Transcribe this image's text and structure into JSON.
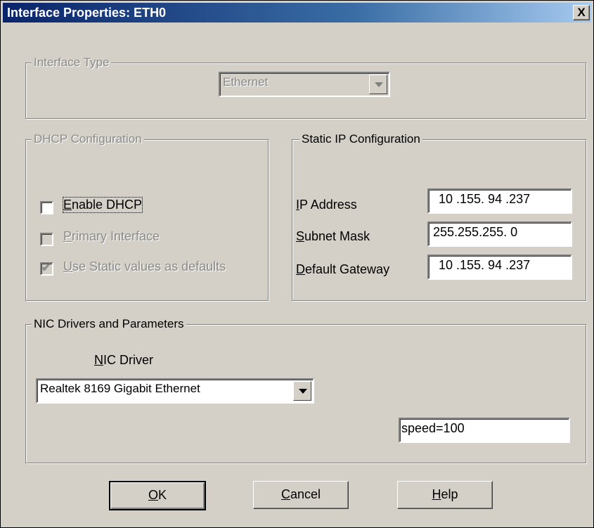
{
  "window": {
    "title": "Interface Properties: ETH0",
    "close_label": "X"
  },
  "interface_type": {
    "legend": "Interface Type",
    "selected": "Ethernet"
  },
  "dhcp": {
    "legend": "DHCP Configuration",
    "enable_dhcp": {
      "label_accel": "E",
      "label_rest": "nable DHCP",
      "checked": false
    },
    "primary_interface": {
      "label_accel": "P",
      "label_rest": "rimary Interface",
      "checked": false
    },
    "use_static_defaults": {
      "label_accel": "U",
      "label_rest": "se Static values as defaults",
      "checked": true,
      "check_glyph": "✔"
    }
  },
  "static_ip": {
    "legend": "Static IP Configuration",
    "ip_address": {
      "label_accel": "I",
      "label_rest": "P Address",
      "value": "10 .155. 94 .237"
    },
    "subnet_mask": {
      "label_accel": "S",
      "label_rest": "ubnet Mask",
      "value": "255.255.255.  0"
    },
    "default_gateway": {
      "label_accel": "D",
      "label_rest": "efault Gateway",
      "value": "10 .155. 94 .237"
    }
  },
  "nic": {
    "legend": "NIC Drivers and Parameters",
    "driver_label_accel": "N",
    "driver_label_rest": "IC Driver",
    "driver_selected": "Realtek 8169 Gigabit Ethernet",
    "parameters": "speed=100"
  },
  "buttons": {
    "ok": {
      "accel": "O",
      "rest": "K"
    },
    "cancel": {
      "accel": "C",
      "rest": "ancel"
    },
    "help": {
      "accel": "H",
      "rest": "elp"
    }
  }
}
